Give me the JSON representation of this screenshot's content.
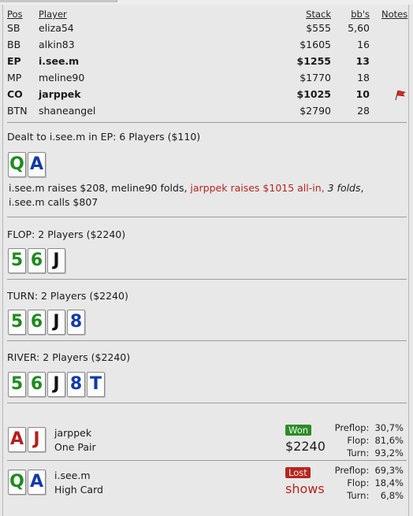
{
  "columns": {
    "pos": "Pos",
    "player": "Player",
    "stack": "Stack",
    "bbs": "bb's",
    "notes": "Notes"
  },
  "players": [
    {
      "pos": "SB",
      "name": "eliza54",
      "stack": "$555",
      "bbs": "5,60",
      "bold": false
    },
    {
      "pos": "BB",
      "name": "alkin83",
      "stack": "$1605",
      "bbs": "16",
      "bold": false
    },
    {
      "pos": "EP",
      "name": "i.see.m",
      "stack": "$1255",
      "bbs": "13",
      "bold": true
    },
    {
      "pos": "MP",
      "name": "meline90",
      "stack": "$1770",
      "bbs": "18",
      "bold": false
    },
    {
      "pos": "CO",
      "name": "jarppek",
      "stack": "$1025",
      "bbs": "10",
      "bold": true,
      "note_icon": "red-flag-icon"
    },
    {
      "pos": "BTN",
      "name": "shaneangel",
      "stack": "$2790",
      "bbs": "28",
      "bold": false
    }
  ],
  "preflop": {
    "title": "Dealt to i.see.m in EP: 6 Players ($110)",
    "cards": [
      {
        "rank": "Q",
        "suit": "clubs"
      },
      {
        "rank": "A",
        "suit": "diamonds"
      }
    ],
    "action_1": "i.see.m raises $208, meline90 folds, ",
    "action_red": "jarppek raises $1015 all-in,",
    "action_italic": " 3 folds",
    "action_2": ", i.see.m calls $807"
  },
  "flop": {
    "title": "FLOP: 2 Players ($2240)",
    "cards": [
      {
        "rank": "5",
        "suit": "clubs"
      },
      {
        "rank": "6",
        "suit": "clubs"
      },
      {
        "rank": "J",
        "suit": "spades"
      }
    ]
  },
  "turn": {
    "title": "TURN: 2 Players ($2240)",
    "cards": [
      {
        "rank": "5",
        "suit": "clubs"
      },
      {
        "rank": "6",
        "suit": "clubs"
      },
      {
        "rank": "J",
        "suit": "spades"
      },
      {
        "rank": "8",
        "suit": "diamonds"
      }
    ]
  },
  "river": {
    "title": "RIVER: 2 Players ($2240)",
    "cards": [
      {
        "rank": "5",
        "suit": "clubs"
      },
      {
        "rank": "6",
        "suit": "clubs"
      },
      {
        "rank": "J",
        "suit": "spades"
      },
      {
        "rank": "8",
        "suit": "diamonds"
      },
      {
        "rank": "T",
        "suit": "diamonds"
      }
    ]
  },
  "results": [
    {
      "cards": [
        {
          "rank": "A",
          "suit": "hearts"
        },
        {
          "rank": "J",
          "suit": "hearts"
        }
      ],
      "name": "jarppek",
      "hand": "One Pair",
      "badge": "Won",
      "badge_type": "won",
      "value": "$2240",
      "equity": {
        "preflop_label": "Preflop:",
        "preflop": "30,7%",
        "flop_label": "Flop:",
        "flop": "81,6%",
        "turn_label": "Turn:",
        "turn": "93,2%"
      }
    },
    {
      "cards": [
        {
          "rank": "Q",
          "suit": "clubs"
        },
        {
          "rank": "A",
          "suit": "diamonds"
        }
      ],
      "name": "i.see.m",
      "hand": "High Card",
      "badge": "Lost",
      "badge_type": "lost",
      "value": "shows",
      "equity": {
        "preflop_label": "Preflop:",
        "preflop": "69,3%",
        "flop_label": "Flop:",
        "flop": "18,4%",
        "turn_label": "Turn:",
        "turn": "6,8%"
      }
    }
  ],
  "colors": {
    "clubs": "#1f8a1f",
    "diamonds": "#123aa8",
    "spades": "#111111",
    "hearts": "#b51d1d",
    "won": "#2d8b2a",
    "lost": "#b3261e"
  }
}
